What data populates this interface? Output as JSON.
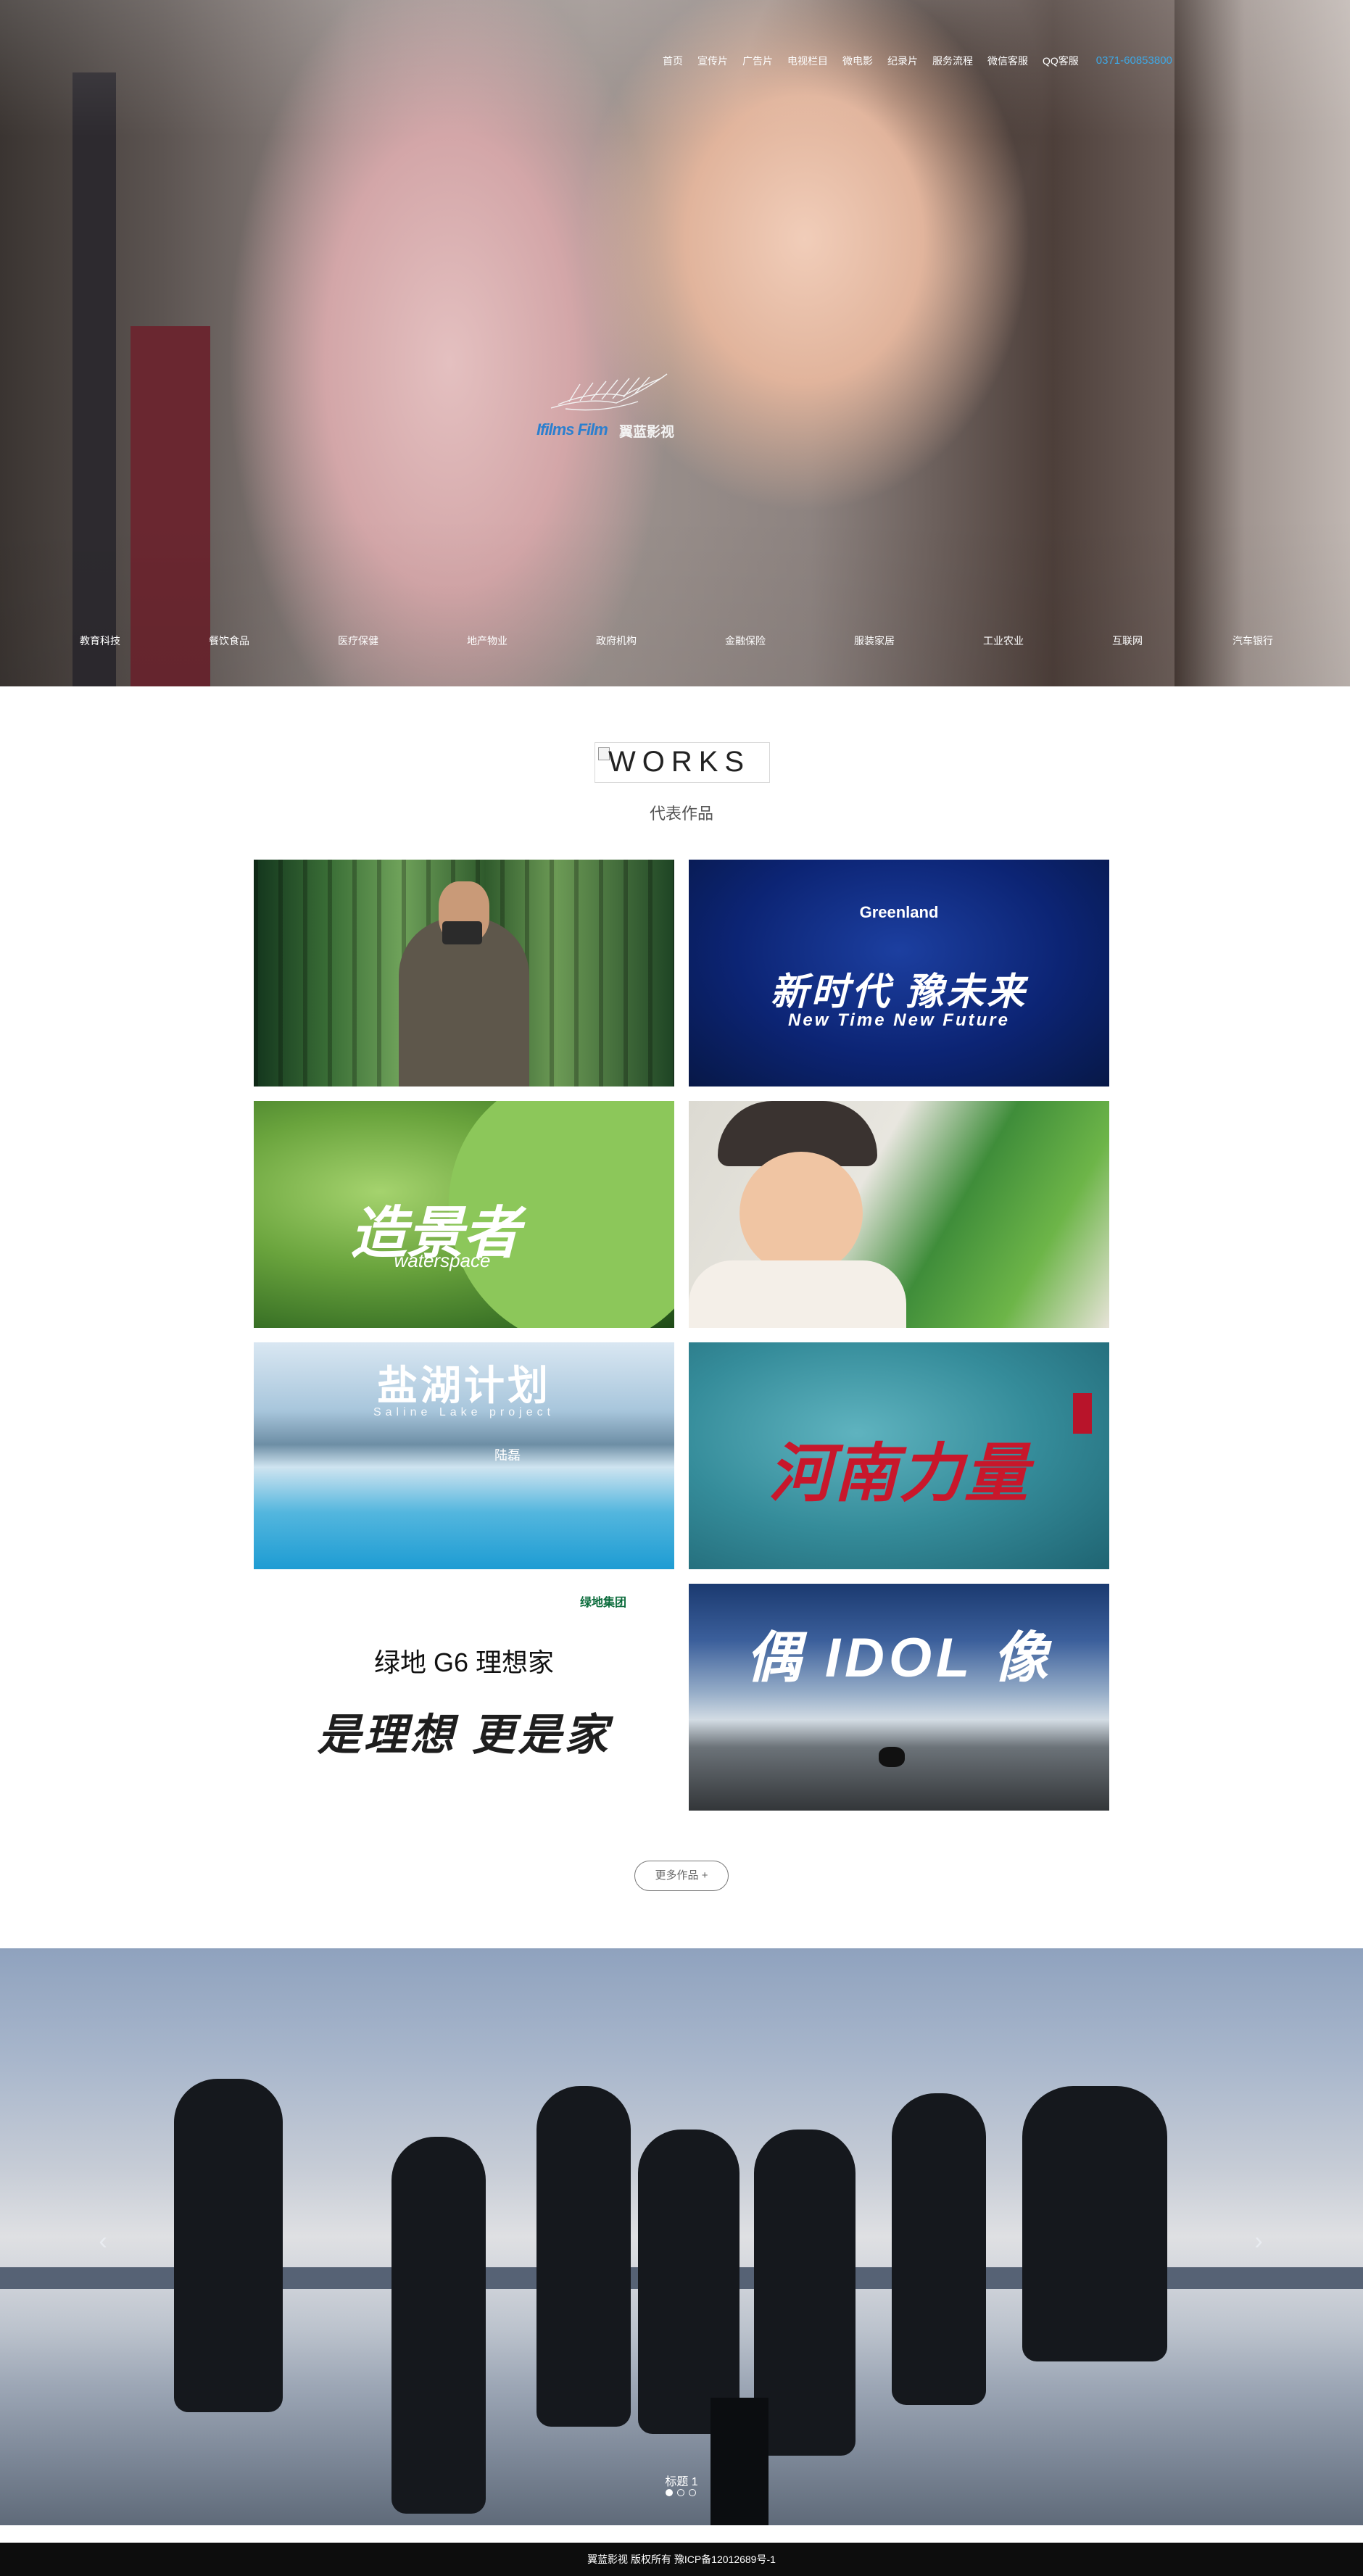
{
  "nav": {
    "items": [
      "首页",
      "宣传片",
      "广告片",
      "电视栏目",
      "微电影",
      "纪录片",
      "服务流程",
      "微信客服",
      "QQ客服"
    ],
    "phone": "0371-60853800"
  },
  "logo": {
    "text_en": "Ifilms Film",
    "text_cn": "翼蓝影视"
  },
  "categories": [
    "教育科技",
    "餐饮食品",
    "医疗保健",
    "地产物业",
    "政府机构",
    "金融保险",
    "服装家居",
    "工业农业",
    "互联网",
    "汽车银行"
  ],
  "works": {
    "title": "WORKS",
    "subtitle": "代表作品",
    "items": [
      {
        "name": "bamboo-photographer"
      },
      {
        "name": "greenland-new-time",
        "brand": "Greenland",
        "title": "新时代 豫未来",
        "subtitle": "New Time   New Future"
      },
      {
        "name": "waterspace",
        "title": "造景者",
        "subtitle": "waterspace"
      },
      {
        "name": "child-painting"
      },
      {
        "name": "saline-lake",
        "title": "盐湖计划",
        "subtitle": "Saline Lake project",
        "sign": "陆磊"
      },
      {
        "name": "henan-power",
        "title": "河南力量"
      },
      {
        "name": "greenland-dream-home",
        "brand": "绿地集团",
        "title": "绿地 G6 理想家",
        "subtitle": "是理想 更是家"
      },
      {
        "name": "idol",
        "title": "偶 IDOL 像"
      }
    ],
    "more_label": "更多作品 +"
  },
  "team_slider": {
    "caption": "标题 1",
    "prev_label": "‹",
    "next_label": "›",
    "dots": 3,
    "active_dot": 0
  },
  "footer": {
    "text": "翼蓝影视 版权所有 豫ICP备12012689号-1"
  },
  "colors": {
    "accent_blue": "#2b7fcf",
    "phone_blue": "#3ea8e6",
    "footer_bg": "#0d0d0d"
  }
}
